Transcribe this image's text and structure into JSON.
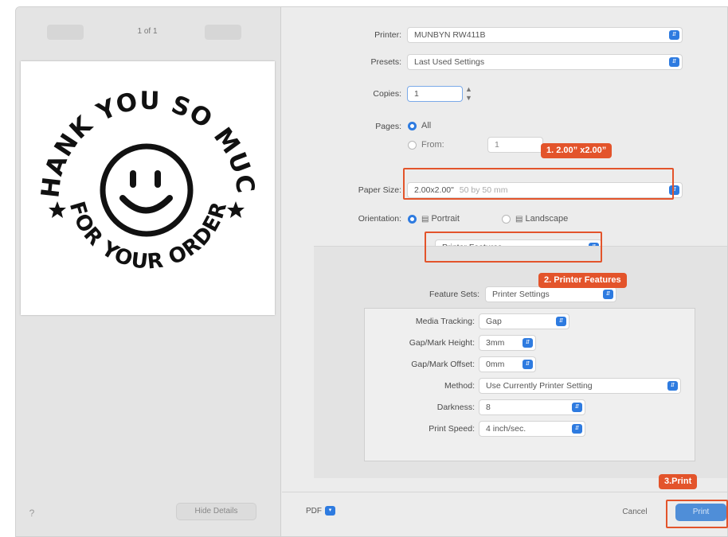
{
  "preview_pane": {
    "prev_label": "",
    "next_label": "",
    "page_counter": "1 of 1",
    "label_top_text": "THANK YOU SO MUCH",
    "label_bottom_text": "FOR YOUR ORDER",
    "help_label": "?",
    "hide_details_label": "Hide Details"
  },
  "print_settings": {
    "printer_label": "Printer:",
    "printer_value": "MUNBYN RW411B",
    "presets_label": "Presets:",
    "presets_value": "Last Used Settings",
    "copies_label": "Copies:",
    "copies_value": "1",
    "pages_label": "Pages:",
    "pages_all_label": "All",
    "pages_from_label": "From:",
    "pages_from_value": "1",
    "paper_size_label": "Paper Size:",
    "paper_size_value": "2.00x2.00\"",
    "paper_size_detail": "50 by 50 mm",
    "orientation_label": "Orientation:",
    "orientation_portrait": "Portrait",
    "orientation_landscape": "Landscape",
    "section_popup_value": "Printer Features",
    "feature_sets_label": "Feature Sets:",
    "feature_sets_value": "Printer Settings"
  },
  "printer_features": [
    {
      "label": "Media Tracking:",
      "value": "Gap"
    },
    {
      "label": "Gap/Mark Height:",
      "value": "3mm"
    },
    {
      "label": "Gap/Mark Offset:",
      "value": "0mm"
    },
    {
      "label": "Method:",
      "value": "Use Currently Printer Setting"
    },
    {
      "label": "Darkness:",
      "value": "8"
    },
    {
      "label": "Print Speed:",
      "value": "4 inch/sec."
    }
  ],
  "footer": {
    "pdf_label": "PDF",
    "cancel_label": "Cancel",
    "print_label": "Print"
  },
  "annotations": {
    "step1": "1. 2.00” x2.00”",
    "step2": "2. Printer Features",
    "step3": "3.Print"
  },
  "colors": {
    "accent": "#2e7be0",
    "highlight": "#e3542b",
    "dialog_bg": "#ececec"
  }
}
